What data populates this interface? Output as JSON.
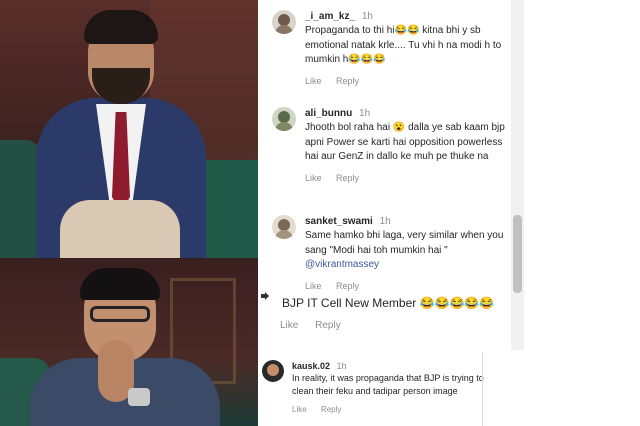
{
  "comments": [
    {
      "username": "_i_am_kz_",
      "time": "1h",
      "text": "Propaganda to thi hi😂😂 kitna bhi y sb emotional natak krle.... Tu vhi h na modi h to mumkin h😂😂😂",
      "like": "Like",
      "reply": "Reply"
    },
    {
      "username": "ali_bunnu",
      "time": "1h",
      "text": "Jhooth bol raha hai 😮 dalla ye sab kaam bjp apni Power se karti hai opposition powerless hai aur GenZ in dallo ke muh pe thuke na",
      "like": "Like",
      "reply": "Reply"
    },
    {
      "username": "sanket_swami",
      "time": "1h",
      "text": "Same hamko bhi laga, very similar when you sang \"Modi hai toh mumkin hai \" ",
      "mention": "@vikrantmassey",
      "like": "Like",
      "reply": "Reply"
    }
  ],
  "reply_comment": {
    "text": "BJP IT Cell New Member 😂😂😂😂😂",
    "like": "Like",
    "reply": "Reply",
    "icon": "reply-arrow-icon"
  },
  "bottom_comment": {
    "username": "kausk.02",
    "time": "1h",
    "text": "In reality, it was propaganda that BJP is trying to clean their feku and tadipar person image",
    "like": "Like",
    "reply": "Reply"
  }
}
